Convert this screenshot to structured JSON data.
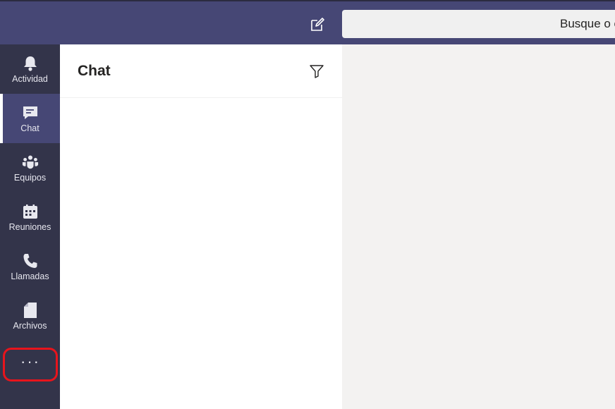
{
  "header": {
    "compose_icon": "compose-icon",
    "search_placeholder": "Busque o escriba un comando"
  },
  "rail": {
    "items": [
      {
        "label": "Actividad",
        "icon": "bell-icon",
        "active": false
      },
      {
        "label": "Chat",
        "icon": "chat-icon",
        "active": true
      },
      {
        "label": "Equipos",
        "icon": "teams-icon",
        "active": false
      },
      {
        "label": "Reuniones",
        "icon": "calendar-icon",
        "active": false
      },
      {
        "label": "Llamadas",
        "icon": "phone-icon",
        "active": false
      },
      {
        "label": "Archivos",
        "icon": "file-icon",
        "active": false
      }
    ],
    "more_label": "···"
  },
  "chat": {
    "title": "Chat",
    "filter_icon": "filter-icon"
  },
  "colors": {
    "topbar": "#464775",
    "rail": "#33344a",
    "rail_active": "#464775",
    "highlight": "#e8141c",
    "main_bg": "#f3f2f1"
  }
}
